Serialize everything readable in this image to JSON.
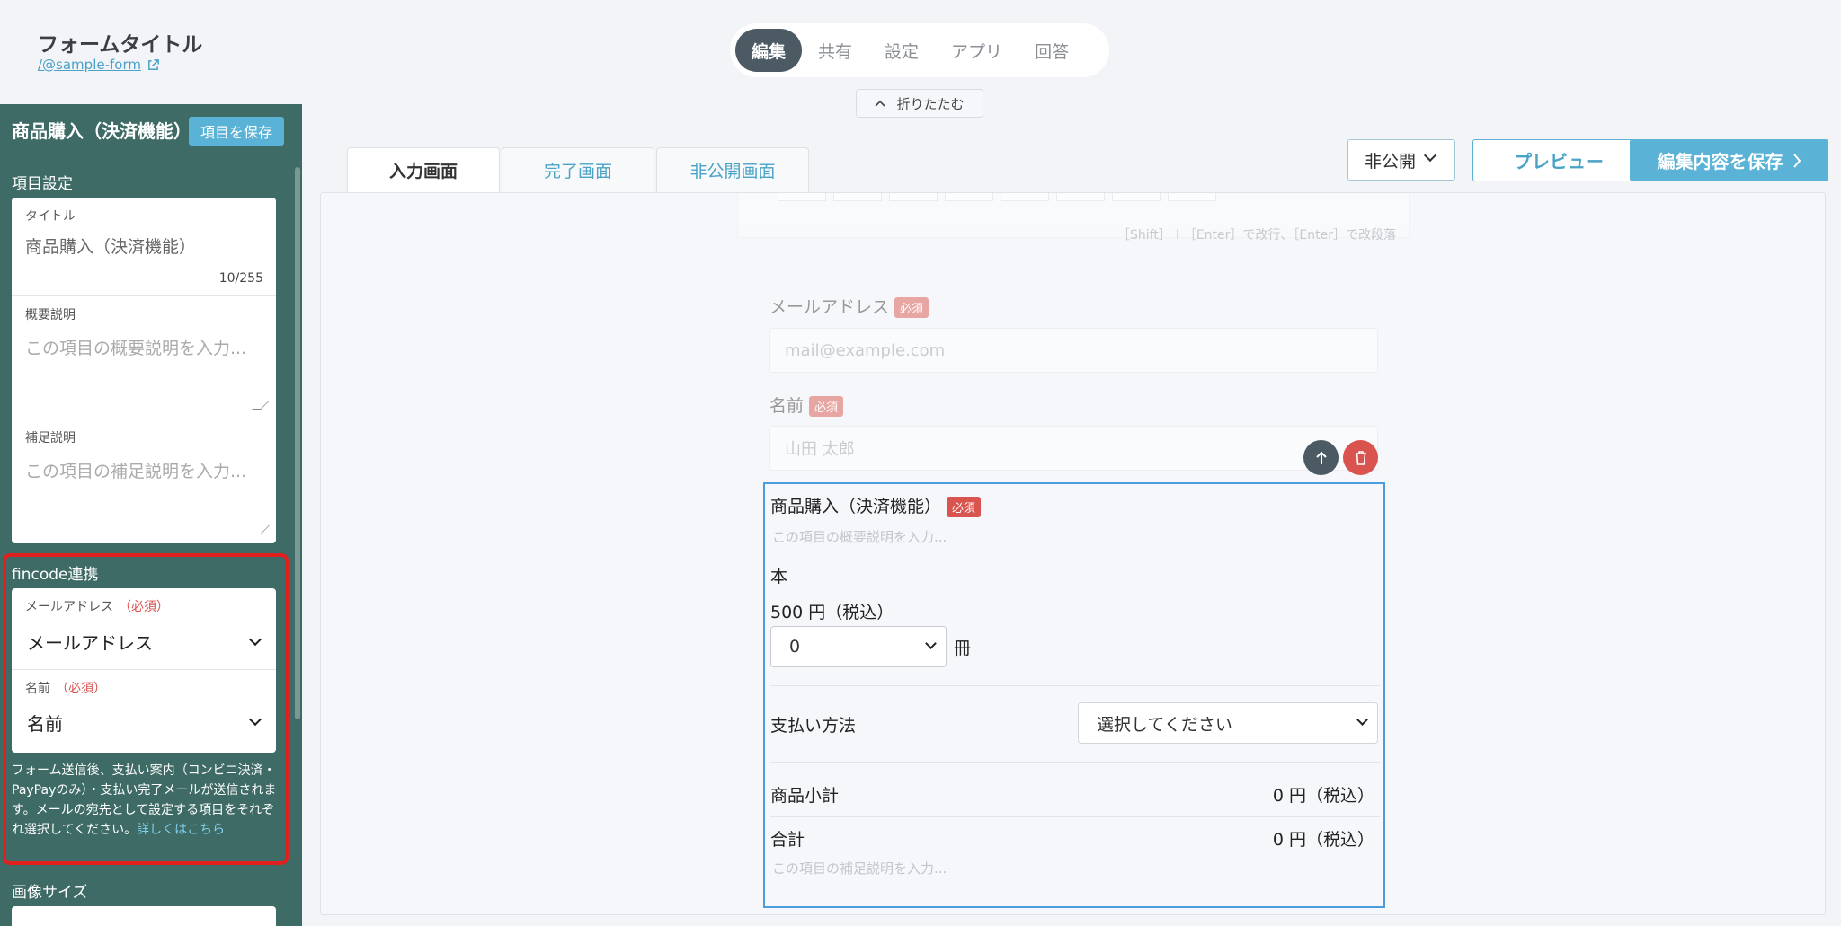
{
  "header": {
    "form_title": "フォームタイトル",
    "form_url": "/@sample-form",
    "nav_tabs": [
      "編集",
      "共有",
      "設定",
      "アプリ",
      "回答"
    ],
    "collapse_label": "折りたたむ"
  },
  "sidebar": {
    "heading": "商品購入（決済機能）",
    "save_item_label": "項目を保存",
    "item_settings_label": "項目設定",
    "title_label": "タイトル",
    "title_value": "商品購入（決済機能）",
    "title_count": "10/255",
    "summary_label": "概要説明",
    "summary_placeholder": "この項目の概要説明を入力...",
    "supplement_label": "補足説明",
    "supplement_placeholder": "この項目の補足説明を入力...",
    "fincode_label": "fincode連携",
    "email_label": "メールアドレス",
    "required_text": "（必須）",
    "email_select_value": "メールアドレス",
    "name_label": "名前",
    "name_select_value": "名前",
    "fincode_note": "フォーム送信後、支払い案内（コンビニ決済・PayPayのみ）・支払い完了メールが送信されます。メールの宛先として設定する項目をそれぞれ選択してください。",
    "fincode_link": "詳しくはこちら",
    "image_size_label": "画像サイズ"
  },
  "main": {
    "page_tabs": [
      "入力画面",
      "完了画面",
      "非公開画面"
    ],
    "visibility_value": "非公開",
    "preview_label": "プレビュー",
    "save_edit_label": "編集内容を保存",
    "toolbar_hint": "［Shift］＋［Enter］で改行、［Enter］で改段落",
    "email_field_label": "メールアドレス",
    "email_placeholder": "mail@example.com",
    "name_field_label": "名前",
    "name_placeholder": "山田 太郎",
    "required_badge": "必須",
    "product": {
      "title": "商品購入（決済機能）",
      "summary_placeholder": "この項目の概要説明を入力...",
      "item_name": "本",
      "price": "500 円（税込）",
      "quantity_value": "0",
      "quantity_unit": "冊",
      "payment_label": "支払い方法",
      "payment_placeholder": "選択してください",
      "subtotal_label": "商品小計",
      "subtotal_value": "0 円（税込）",
      "total_label": "合計",
      "total_value": "0 円（税込）",
      "supplement_placeholder": "この項目の補足説明を入力..."
    }
  },
  "colors": {
    "sidebar_bg": "#3e6b66",
    "accent": "#5ab2d6",
    "nav_active": "#4b5a63",
    "highlight_border": "#e0201e",
    "selected_border": "#4a9ee0"
  }
}
